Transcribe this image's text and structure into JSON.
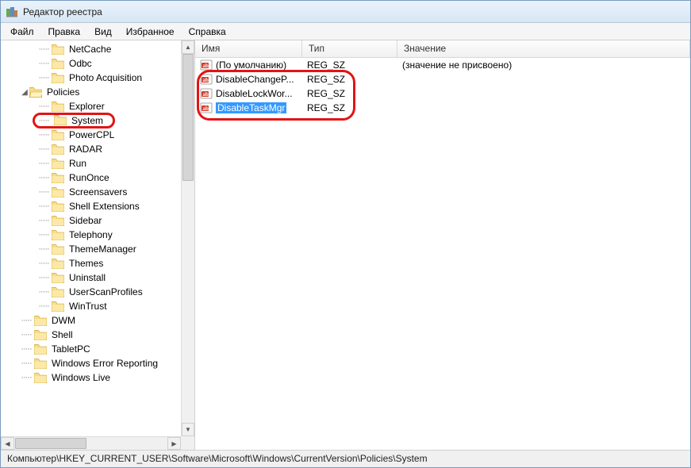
{
  "window": {
    "title": "Редактор реестра"
  },
  "menu": {
    "items": [
      "Файл",
      "Правка",
      "Вид",
      "Избранное",
      "Справка"
    ]
  },
  "tree": {
    "items": [
      {
        "label": "NetCache",
        "indent": 2,
        "expander": ""
      },
      {
        "label": "Odbc",
        "indent": 2,
        "expander": ""
      },
      {
        "label": "Photo Acquisition",
        "indent": 2,
        "expander": ""
      },
      {
        "label": "Policies",
        "indent": 1,
        "expander": "◢"
      },
      {
        "label": "Explorer",
        "indent": 2,
        "expander": ""
      },
      {
        "label": "System",
        "indent": 2,
        "expander": "",
        "highlighted": true
      },
      {
        "label": "PowerCPL",
        "indent": 2,
        "expander": ""
      },
      {
        "label": "RADAR",
        "indent": 2,
        "expander": ""
      },
      {
        "label": "Run",
        "indent": 2,
        "expander": ""
      },
      {
        "label": "RunOnce",
        "indent": 2,
        "expander": ""
      },
      {
        "label": "Screensavers",
        "indent": 2,
        "expander": ""
      },
      {
        "label": "Shell Extensions",
        "indent": 2,
        "expander": ""
      },
      {
        "label": "Sidebar",
        "indent": 2,
        "expander": ""
      },
      {
        "label": "Telephony",
        "indent": 2,
        "expander": ""
      },
      {
        "label": "ThemeManager",
        "indent": 2,
        "expander": ""
      },
      {
        "label": "Themes",
        "indent": 2,
        "expander": ""
      },
      {
        "label": "Uninstall",
        "indent": 2,
        "expander": ""
      },
      {
        "label": "UserScanProfiles",
        "indent": 2,
        "expander": ""
      },
      {
        "label": "WinTrust",
        "indent": 2,
        "expander": ""
      },
      {
        "label": "DWM",
        "indent": 1,
        "expander": ""
      },
      {
        "label": "Shell",
        "indent": 1,
        "expander": ""
      },
      {
        "label": "TabletPC",
        "indent": 1,
        "expander": ""
      },
      {
        "label": "Windows Error Reporting",
        "indent": 1,
        "expander": ""
      },
      {
        "label": "Windows Live",
        "indent": 1,
        "expander": ""
      }
    ]
  },
  "list": {
    "columns": {
      "name": "Имя",
      "type": "Тип",
      "value": "Значение"
    },
    "rows": [
      {
        "name": "(По умолчанию)",
        "type": "REG_SZ",
        "value": "(значение не присвоено)",
        "selected": false
      },
      {
        "name": "DisableChangeP...",
        "type": "REG_SZ",
        "value": "",
        "selected": false
      },
      {
        "name": "DisableLockWor...",
        "type": "REG_SZ",
        "value": "",
        "selected": false
      },
      {
        "name": "DisableTaskMgr",
        "type": "REG_SZ",
        "value": "",
        "selected": true
      }
    ]
  },
  "statusbar": {
    "path": "Компьютер\\HKEY_CURRENT_USER\\Software\\Microsoft\\Windows\\CurrentVersion\\Policies\\System"
  }
}
